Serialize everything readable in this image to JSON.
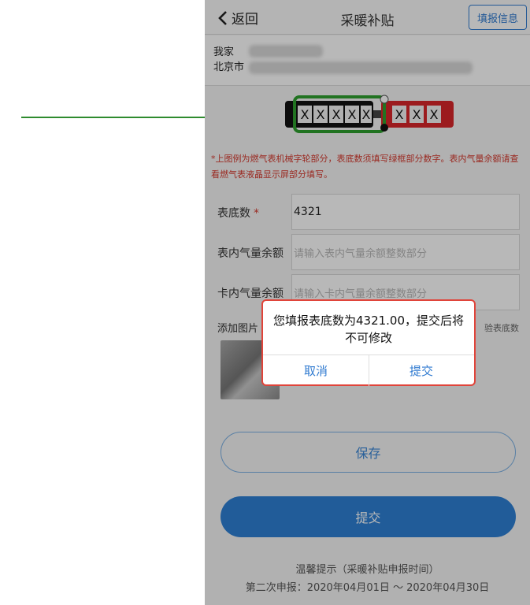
{
  "navbar": {
    "back_label": "返回",
    "title": "采暖补贴",
    "action_label": "填报信息"
  },
  "address": {
    "line1": "我家",
    "line2": "北京市"
  },
  "meter_example": {
    "black_digits": [
      "X",
      "X",
      "X",
      "X",
      "X"
    ],
    "red_digits": [
      "X",
      "X",
      "X"
    ]
  },
  "note": "*上图例为燃气表机械字轮部分，表底数须填写绿框部分数字。表内气量余额请查看燃气表液晶显示屏部分填写。",
  "form": {
    "base_reading_label": "表底数",
    "base_reading_required": "*",
    "base_reading_value": "4321",
    "meter_balance_label": "表内气量余额",
    "meter_balance_placeholder": "请输入表内气量余额整数部分",
    "card_balance_label": "卡内气量余额",
    "card_balance_placeholder": "请输入卡内气量余额整数部分",
    "add_image_label": "添加图片",
    "add_image_hint": "验表底数"
  },
  "buttons": {
    "save": "保存",
    "submit": "提交"
  },
  "tips": {
    "title": "温馨提示（采暖补贴申报时间）",
    "line": "第二次申报：2020年04月01日 ～ 2020年04月30日"
  },
  "dialog": {
    "message": "您填报表底数为4321.00，提交后将不可修改",
    "cancel": "取消",
    "confirm": "提交"
  },
  "colors": {
    "accent": "#2f80d4",
    "warning": "#d63b30",
    "highlight": "#2ea02e"
  }
}
